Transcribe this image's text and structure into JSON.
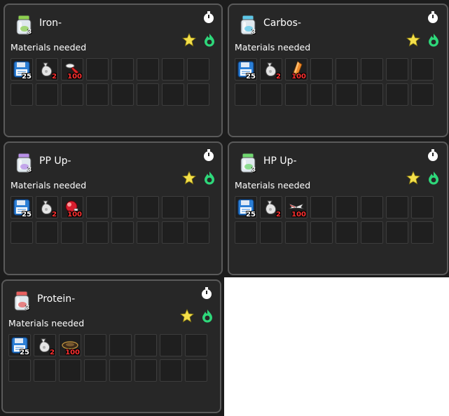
{
  "cards": [
    {
      "title": "Iron-",
      "jar_color": "#8ed050",
      "jar_count": "3",
      "materials_label": "Materials needed",
      "materials": [
        {
          "icon": "floppy-disk-icon",
          "qty": "25",
          "qty_color": "white"
        },
        {
          "icon": "sack-icon",
          "qty": "2",
          "qty_color": "red"
        },
        {
          "icon": "spray-item-icon",
          "qty": "100",
          "qty_color": "red"
        }
      ]
    },
    {
      "title": "Carbos-",
      "jar_color": "#5ec8e8",
      "jar_count": "3",
      "materials_label": "Materials needed",
      "materials": [
        {
          "icon": "floppy-disk-icon",
          "qty": "25",
          "qty_color": "white"
        },
        {
          "icon": "sack-icon",
          "qty": "2",
          "qty_color": "red"
        },
        {
          "icon": "orange-shard-icon",
          "qty": "100",
          "qty_color": "red"
        }
      ]
    },
    {
      "title": "PP Up-",
      "jar_color": "#b890e8",
      "jar_count": "3",
      "materials_label": "Materials needed",
      "materials": [
        {
          "icon": "floppy-disk-icon",
          "qty": "25",
          "qty_color": "white"
        },
        {
          "icon": "sack-icon",
          "qty": "2",
          "qty_color": "red"
        },
        {
          "icon": "red-orb-icon",
          "qty": "100",
          "qty_color": "red"
        }
      ]
    },
    {
      "title": "HP Up-",
      "jar_color": "#70d870",
      "jar_count": "3",
      "materials_label": "Materials needed",
      "materials": [
        {
          "icon": "floppy-disk-icon",
          "qty": "25",
          "qty_color": "white"
        },
        {
          "icon": "sack-icon",
          "qty": "2",
          "qty_color": "red"
        },
        {
          "icon": "wings-icon",
          "qty": "100",
          "qty_color": "red"
        }
      ]
    },
    {
      "title": "Protein-",
      "jar_color": "#e86060",
      "jar_count": "3",
      "materials_label": "Materials needed",
      "materials": [
        {
          "icon": "floppy-disk-icon",
          "qty": "25",
          "qty_color": "white"
        },
        {
          "icon": "sack-icon",
          "qty": "2",
          "qty_color": "red"
        },
        {
          "icon": "dark-disc-icon",
          "qty": "100",
          "qty_color": "red"
        }
      ]
    }
  ],
  "colors": {
    "panel_bg": "#272727",
    "panel_border": "#5a5a5a",
    "slot_bg": "#1f1f1f",
    "star": "#f4e04a",
    "flame": "#2ed87a",
    "qty_red": "#ff3030"
  }
}
